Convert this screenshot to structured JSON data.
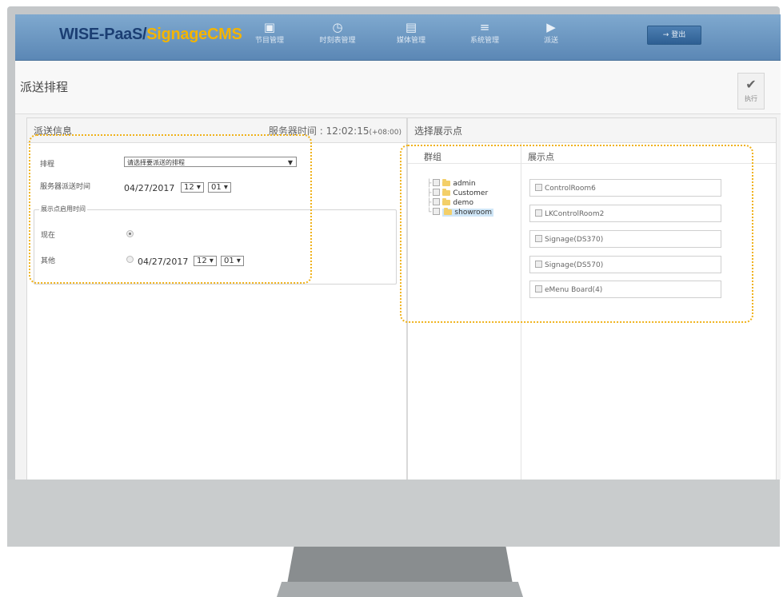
{
  "header": {
    "logo_part1": "WISE-PaaS/",
    "logo_part2": "SignageCMS",
    "nav": [
      {
        "label": "节目管理",
        "icon": "schedule-icon"
      },
      {
        "label": "时刻表管理",
        "icon": "clock-icon"
      },
      {
        "label": "媒体管理",
        "icon": "media-icon"
      },
      {
        "label": "系统管理",
        "icon": "settings-icon"
      },
      {
        "label": "派送",
        "icon": "dispatch-icon"
      }
    ],
    "logout_label": "登出"
  },
  "page": {
    "title": "派送排程",
    "execute_label": "执行"
  },
  "left_panel": {
    "title": "派送信息",
    "server_time_label": "服务器时间 : 12:02:15",
    "server_time_tz": "(+08:00)",
    "schedule_label": "排程",
    "schedule_placeholder": "请选择要派送的排程",
    "server_dispatch_label": "服务器派送时间",
    "dispatch_date": "04/27/2017",
    "dispatch_hour": "12 ▾",
    "dispatch_minute": "01 ▾",
    "enable_legend": "展示点启用时间",
    "now_label": "现在",
    "other_label": "其他",
    "other_date": "04/27/2017",
    "other_hour": "12 ▾",
    "other_minute": "01 ▾"
  },
  "right_panel": {
    "title": "选择展示点",
    "group_header": "群组",
    "sites_header": "展示点",
    "groups": [
      "admin",
      "Customer",
      "demo",
      "showroom"
    ],
    "selected_group": "showroom",
    "sites": [
      "ControlRoom6",
      "LKControlRoom2",
      "Signage(DS370)",
      "Signage(DS570)",
      "eMenu Board(4)"
    ]
  },
  "colors": {
    "accent": "#f4b400",
    "header": "#5b87b5",
    "highlight_border": "#f0b21b"
  }
}
